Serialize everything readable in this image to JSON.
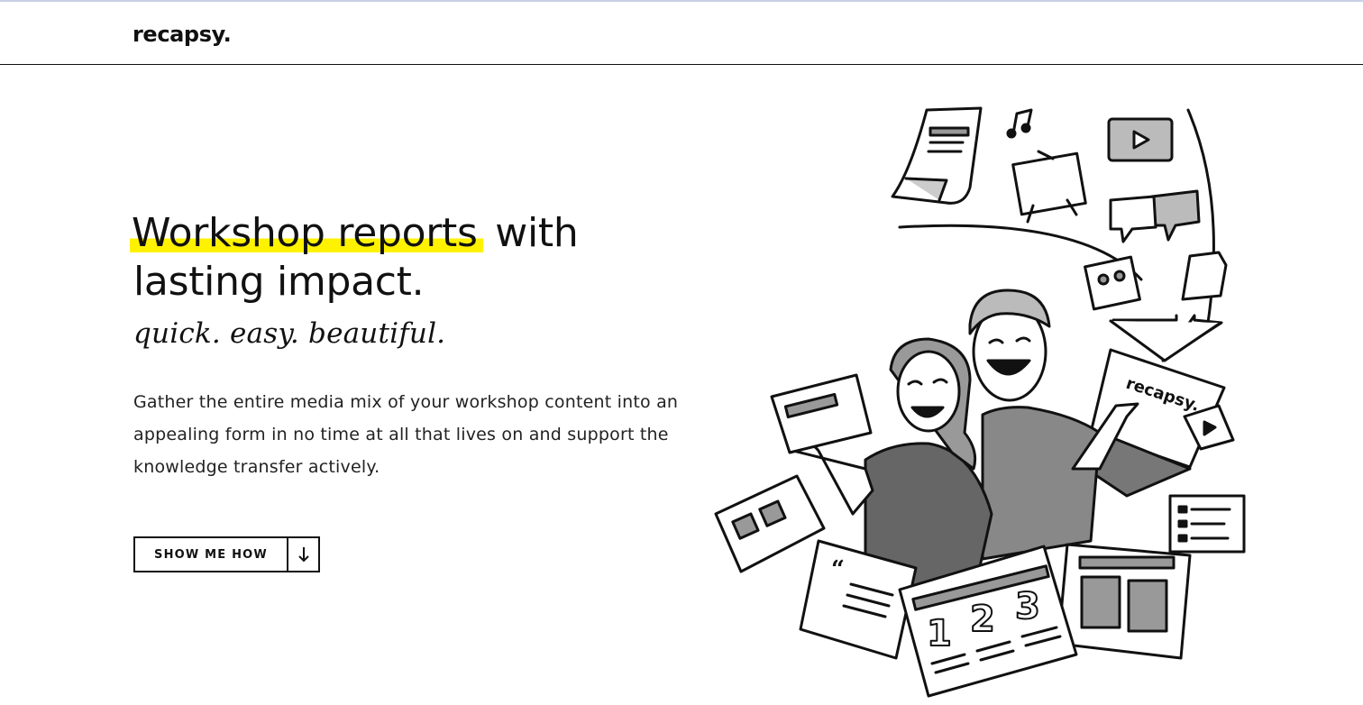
{
  "header": {
    "logo": "recapsy."
  },
  "hero": {
    "title_highlight": "Workshop reports",
    "title_rest": " with lasting impact.",
    "tagline": "quick. easy. beautiful.",
    "description": "Gather the entire media mix of your workshop content into an appealing form in no time at all that lives on and support the knowledge transfer actively.",
    "cta_label": "SHOW ME HOW",
    "cta_icon": "arrow-down-icon"
  },
  "illustration": {
    "laptop_logo": "recapsy.",
    "numbers": [
      "1",
      "2",
      "3"
    ]
  },
  "colors": {
    "highlight": "#fff200",
    "text": "#111111",
    "border": "#111111"
  }
}
